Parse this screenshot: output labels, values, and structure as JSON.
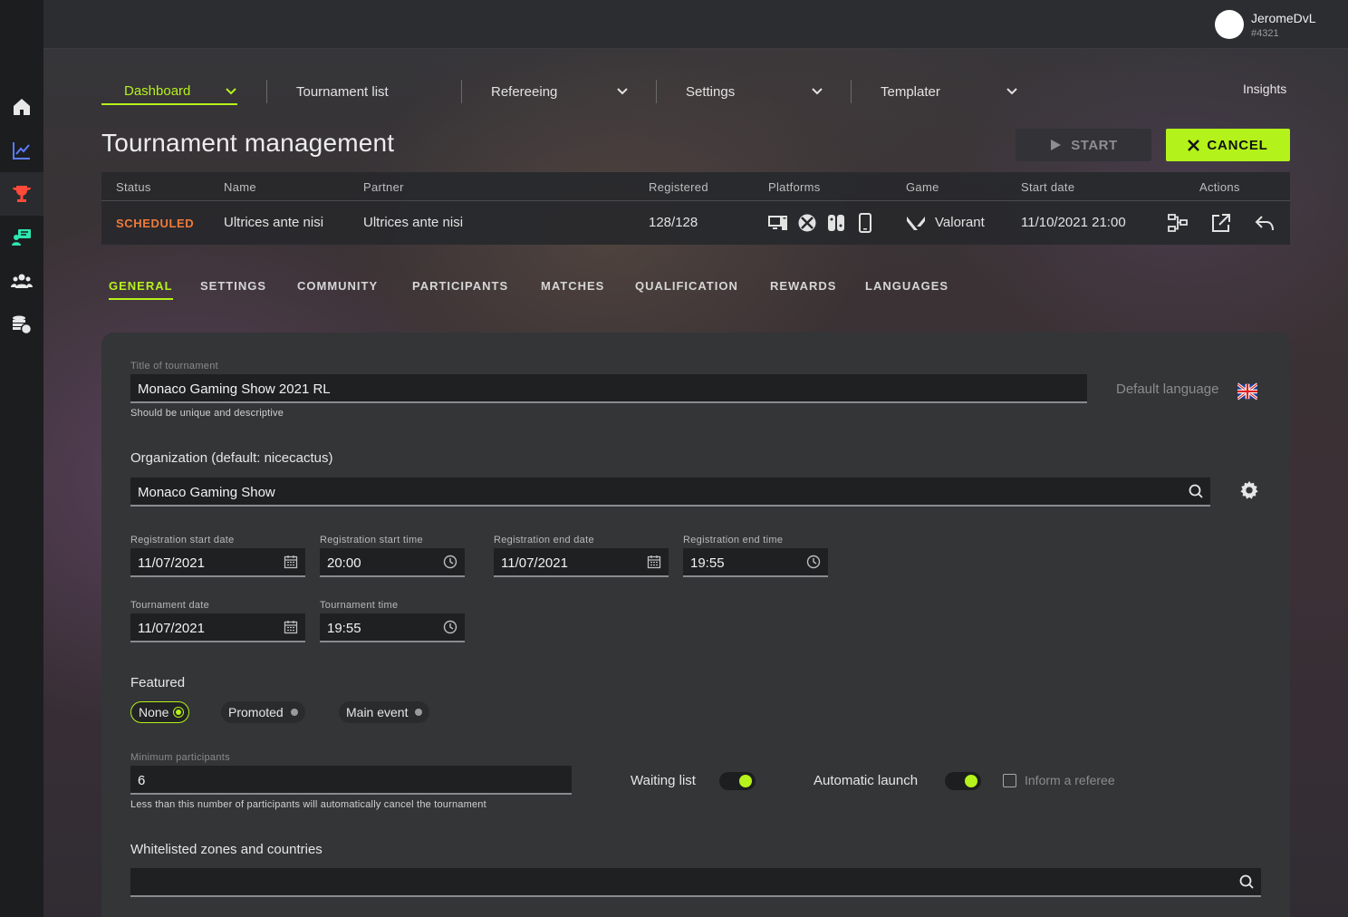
{
  "user": {
    "name": "JeromeDvL",
    "tag": "#4321"
  },
  "sidebar": {
    "items": [
      {
        "icon": "home-icon"
      },
      {
        "icon": "chart-icon"
      },
      {
        "icon": "trophy-icon"
      },
      {
        "icon": "referee-icon"
      },
      {
        "icon": "users-icon"
      },
      {
        "icon": "coins-icon"
      }
    ]
  },
  "nav": {
    "items": [
      {
        "label": "Dashboard",
        "active": true
      },
      {
        "label": "Tournament list"
      },
      {
        "label": "Refereeing"
      },
      {
        "label": "Settings"
      },
      {
        "label": "Templater"
      }
    ],
    "insights": "Insights"
  },
  "page": {
    "title": "Tournament management",
    "start_label": "START",
    "cancel_label": "CANCEL"
  },
  "table": {
    "headers": [
      "Status",
      "Name",
      "Partner",
      "Registered",
      "Platforms",
      "Game",
      "Start date",
      "Actions"
    ],
    "row": {
      "status": "SCHEDULED",
      "name": "Ultrices ante nisi",
      "partner": "Ultrices ante nisi",
      "registered": "128/128",
      "platforms": [
        "pc-icon",
        "xbox-icon",
        "switch-icon",
        "mobile-icon"
      ],
      "game": "Valorant",
      "start_date": "11/10/2021 21:00",
      "actions": [
        "bracket-icon",
        "external-link-icon",
        "undo-icon"
      ]
    }
  },
  "tabs": [
    "GENERAL",
    "SETTINGS",
    "COMMUNITY",
    "PARTICIPANTS",
    "MATCHES",
    "QUALIFICATION",
    "REWARDS",
    "LANGUAGES"
  ],
  "form": {
    "title_label": "Title of tournament",
    "title_value": "Monaco Gaming Show 2021 RL",
    "title_helper": "Should be unique and descriptive",
    "default_language": "Default language",
    "org_label": "Organization (default: nicecactus)",
    "org_value": "Monaco Gaming Show",
    "reg_start_date_label": "Registration start date",
    "reg_start_date": "11/07/2021",
    "reg_start_time_label": "Registration start time",
    "reg_start_time": "20:00",
    "reg_end_date_label": "Registration end date",
    "reg_end_date": "11/07/2021",
    "reg_end_time_label": "Registration end time",
    "reg_end_time": "19:55",
    "tour_date_label": "Tournament date",
    "tour_date": "11/07/2021",
    "tour_time_label": "Tournament time",
    "tour_time": "19:55",
    "featured_label": "Featured",
    "featured_options": [
      "None",
      "Promoted",
      "Main event"
    ],
    "featured_selected": "None",
    "min_participants_label": "Minimum participants",
    "min_participants": "6",
    "min_participants_helper": "Less than this number of participants will automatically cancel the tournament",
    "waiting_list_label": "Waiting list",
    "waiting_list": true,
    "auto_launch_label": "Automatic launch",
    "auto_launch": true,
    "inform_referee_label": "Inform a referee",
    "inform_referee": false,
    "whitelist_label": "Whitelisted zones and countries",
    "whitelist_value": ""
  },
  "colors": {
    "accent": "#b6f21b",
    "status_scheduled": "#f07a3a"
  }
}
